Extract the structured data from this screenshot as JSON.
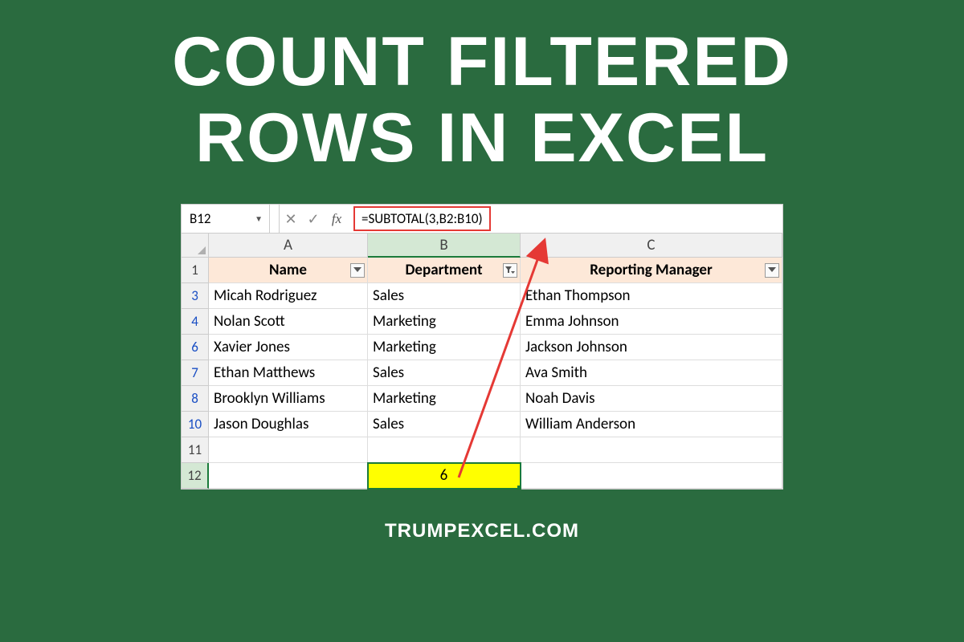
{
  "title_line1": "COUNT FILTERED",
  "title_line2": "ROWS IN EXCEL",
  "footer": "TRUMPEXCEL.COM",
  "excel": {
    "name_box": "B12",
    "formula": "=SUBTOTAL(3,B2:B10)",
    "columns": [
      "A",
      "B",
      "C"
    ],
    "headers": {
      "a": "Name",
      "b": "Department",
      "c": "Reporting Manager"
    },
    "rows": [
      {
        "n": "3",
        "a": "Micah Rodriguez",
        "b": "Sales",
        "c": "Ethan Thompson"
      },
      {
        "n": "4",
        "a": "Nolan Scott",
        "b": "Marketing",
        "c": "Emma Johnson"
      },
      {
        "n": "6",
        "a": "Xavier Jones",
        "b": "Marketing",
        "c": "Jackson Johnson"
      },
      {
        "n": "7",
        "a": "Ethan Matthews",
        "b": "Sales",
        "c": "Ava Smith"
      },
      {
        "n": "8",
        "a": "Brooklyn Williams",
        "b": "Marketing",
        "c": "Noah Davis"
      },
      {
        "n": "10",
        "a": "Jason Doughlas",
        "b": "Sales",
        "c": "William Anderson"
      }
    ],
    "empty_row": "11",
    "result_row": "12",
    "result_value": "6"
  }
}
